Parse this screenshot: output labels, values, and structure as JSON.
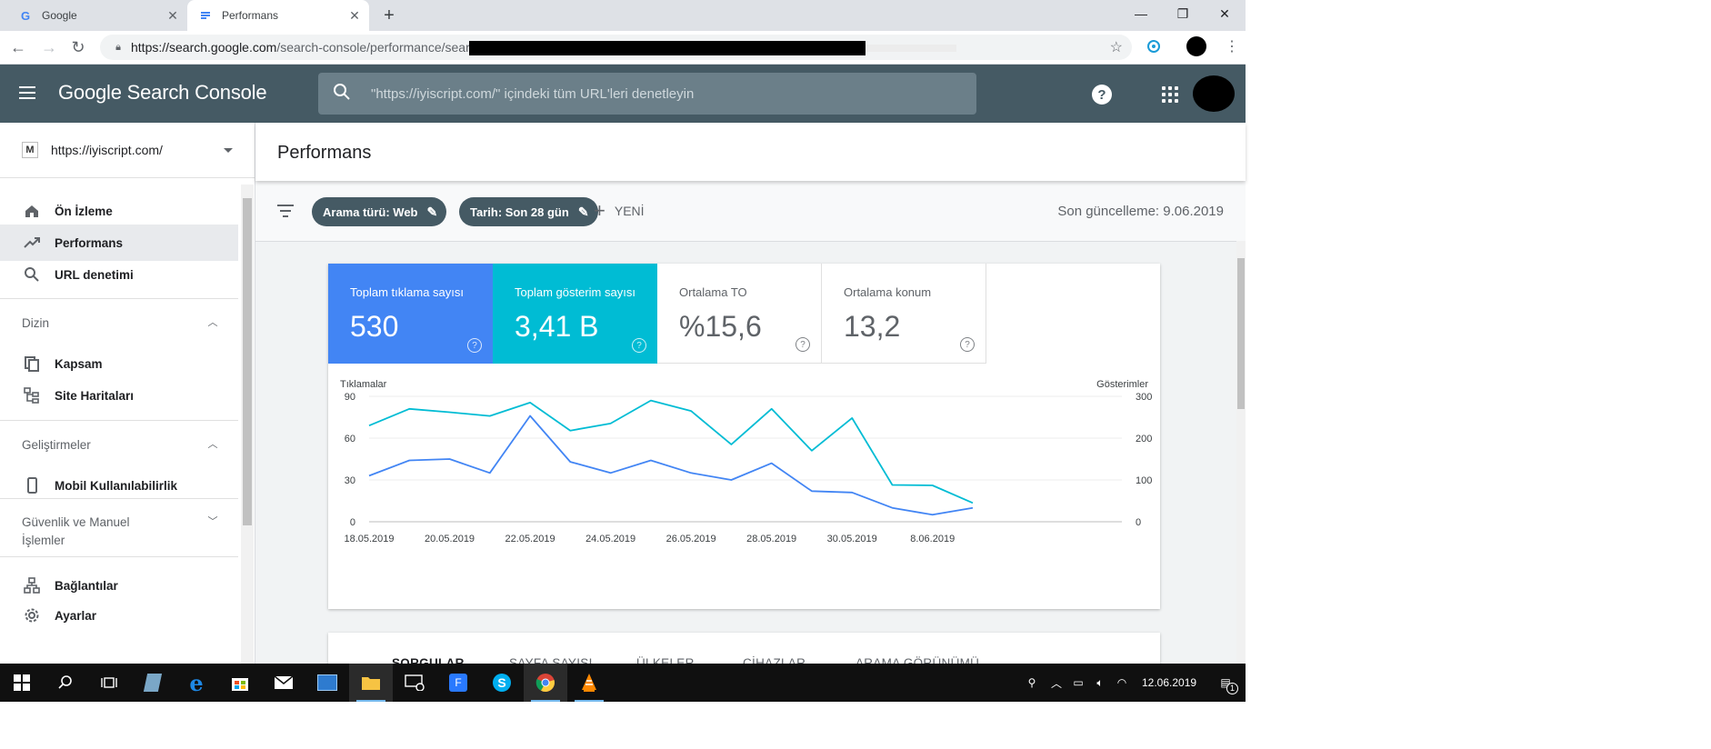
{
  "browser": {
    "tabs": [
      {
        "title": "Google",
        "active": false
      },
      {
        "title": "Performans",
        "active": true
      }
    ],
    "url_host": "https://search.google.com",
    "url_path": "/search-console/performance/searc"
  },
  "app": {
    "brand": "Google Search Console",
    "search_placeholder": "\"https://iyiscript.com/\" içindeki tüm URL'leri denetleyin",
    "help_label": "?"
  },
  "sidebar": {
    "property": "https://iyiscript.com/",
    "top_items": [
      {
        "label": "Ön İzleme",
        "icon": "home-icon"
      },
      {
        "label": "Performans",
        "icon": "trending-up-icon"
      },
      {
        "label": "URL denetimi",
        "icon": "search-icon"
      }
    ],
    "section_dizin": "Dizin",
    "dizin_items": [
      {
        "label": "Kapsam",
        "icon": "copy-icon"
      },
      {
        "label": "Site Haritaları",
        "icon": "sitemap-icon"
      }
    ],
    "section_gelistirmeler": "Geliştirmeler",
    "gelistirmeler_items": [
      {
        "label": "Mobil Kullanılabilirlik",
        "icon": "phone-icon"
      }
    ],
    "section_guvenlik_line1": "Güvenlik ve Manuel",
    "section_guvenlik_line2": "İşlemler",
    "bottom_items": [
      {
        "label": "Bağlantılar",
        "icon": "links-icon"
      },
      {
        "label": "Ayarlar",
        "icon": "gear-icon"
      }
    ]
  },
  "page": {
    "title": "Performans",
    "chips": [
      {
        "label": "Arama türü: Web"
      },
      {
        "label": "Tarih: Son 28 gün"
      }
    ],
    "new_label": "YENİ",
    "updated": "Son güncelleme: 9.06.2019"
  },
  "metrics": [
    {
      "label": "Toplam tıklama sayısı",
      "value": "530"
    },
    {
      "label": "Toplam gösterim sayısı",
      "value": "3,41 B"
    },
    {
      "label": "Ortalama TO",
      "value": "%15,6"
    },
    {
      "label": "Ortalama konum",
      "value": "13,2"
    }
  ],
  "chart_data": {
    "type": "line",
    "left_axis_label": "Tıklamalar",
    "right_axis_label": "Gösterimler",
    "left_ylim": [
      0,
      90
    ],
    "right_ylim": [
      0,
      300
    ],
    "left_ticks": [
      "90",
      "60",
      "30",
      "0"
    ],
    "right_ticks": [
      "300",
      "200",
      "100",
      "0"
    ],
    "x_tick_labels": [
      "18.05.2019",
      "20.05.2019",
      "22.05.2019",
      "24.05.2019",
      "26.05.2019",
      "28.05.2019",
      "30.05.2019",
      "8.06.2019"
    ],
    "series": [
      {
        "name": "Tıklamalar",
        "axis": "left",
        "color": "#4285f4",
        "values": [
          33,
          44,
          45,
          35,
          76,
          43,
          35,
          44,
          35,
          30,
          42,
          22,
          21,
          10,
          5,
          10
        ]
      },
      {
        "name": "Gösterimler",
        "axis": "right",
        "color": "#00bcd4",
        "values": [
          230,
          270,
          262,
          253,
          285,
          218,
          235,
          290,
          265,
          185,
          270,
          170,
          248,
          88,
          87,
          45
        ]
      }
    ],
    "grid": true
  },
  "dim_tabs": [
    {
      "label": "SORGULAR",
      "selected": true
    },
    {
      "label": "SAYFA SAYISI",
      "selected": false
    },
    {
      "label": "ÜLKELER",
      "selected": false
    },
    {
      "label": "CİHAZLAR",
      "selected": false
    },
    {
      "label": "ARAMA GÖRÜNÜMÜ",
      "selected": false
    }
  ],
  "taskbar": {
    "date": "12.06.2019",
    "notif_count": "1"
  },
  "colors": {
    "appbar": "#455a64",
    "clicks": "#4285f4",
    "impressions": "#00bcd4"
  }
}
